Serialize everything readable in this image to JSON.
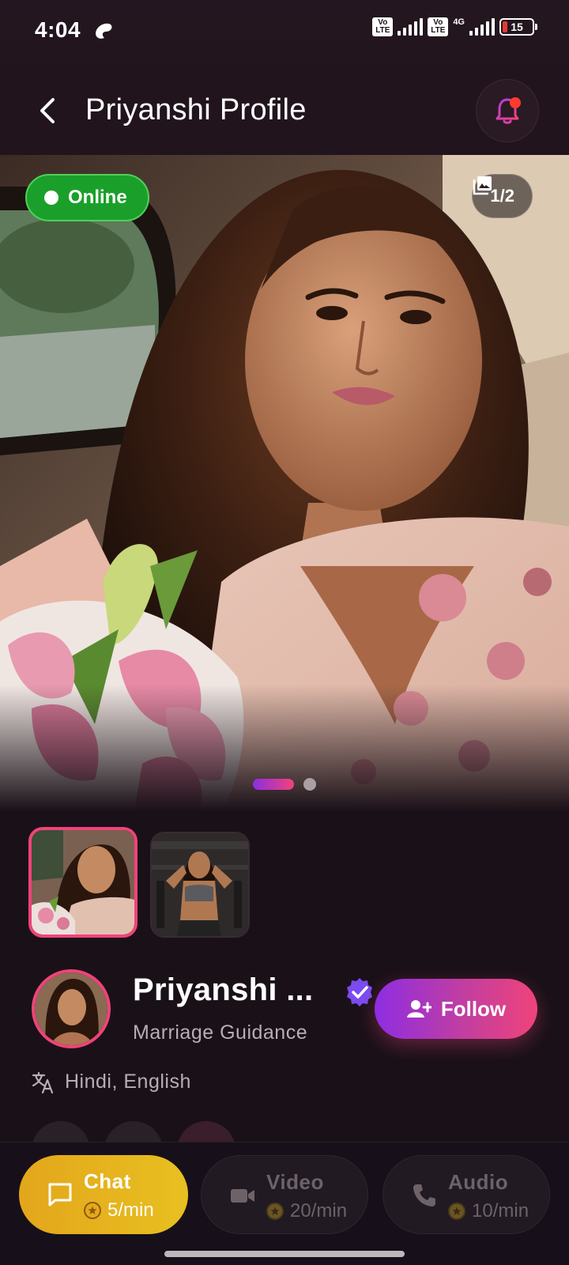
{
  "status_bar": {
    "time": "4:04",
    "volte_1": "Vo LTE",
    "volte_2": "Vo LTE",
    "network": "4G",
    "battery": "15"
  },
  "header": {
    "title": "Priyanshi Profile"
  },
  "hero": {
    "online_label": "Online",
    "photo_counter": "1/2",
    "current_photo": 1,
    "total_photos": 2
  },
  "profile": {
    "name": "Priyanshi ...",
    "subtitle": "Marriage Guidance",
    "follow_label": "Follow",
    "languages": "Hindi, English"
  },
  "actions": {
    "chat": {
      "label": "Chat",
      "price": "5/min"
    },
    "video": {
      "label": "Video",
      "price": "20/min"
    },
    "audio": {
      "label": "Audio",
      "price": "10/min"
    }
  },
  "colors": {
    "background": "#1a1118",
    "accent_pink": "#f0437a",
    "accent_purple": "#8e2de2",
    "online_green": "#1aa02a",
    "chat_gold": "#e3a61c",
    "verified_purple": "#7b4bf0"
  }
}
